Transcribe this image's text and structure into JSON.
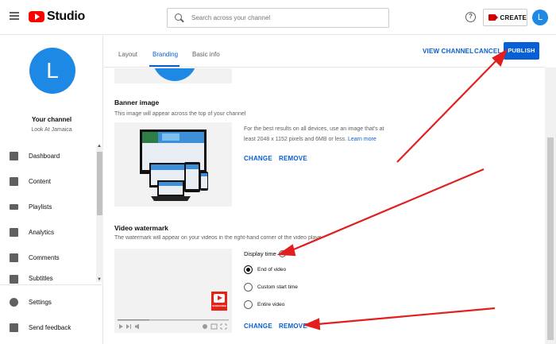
{
  "topbar": {
    "logo_text": "Studio",
    "search_placeholder": "Search across your channel",
    "help_glyph": "?",
    "create_label": "CREATE",
    "avatar_letter": "L"
  },
  "sidebar": {
    "avatar_letter": "L",
    "channel_title": "Your channel",
    "channel_name": "Look At Jamaica",
    "items": [
      {
        "label": "Dashboard",
        "icon": "dashboard-icon"
      },
      {
        "label": "Content",
        "icon": "content-icon"
      },
      {
        "label": "Playlists",
        "icon": "playlists-icon"
      },
      {
        "label": "Analytics",
        "icon": "analytics-icon"
      },
      {
        "label": "Comments",
        "icon": "comments-icon"
      },
      {
        "label": "Subtitles",
        "icon": "subtitles-icon"
      }
    ],
    "bottom_items": [
      {
        "label": "Settings",
        "icon": "gear-icon"
      },
      {
        "label": "Send feedback",
        "icon": "feedback-icon"
      }
    ]
  },
  "tabs": {
    "layout": "Layout",
    "branding": "Branding",
    "basic_info": "Basic info",
    "active": "Branding"
  },
  "header_actions": {
    "view_channel": "VIEW CHANNEL",
    "cancel": "CANCEL",
    "publish": "PUBLISH"
  },
  "banner": {
    "title": "Banner image",
    "description": "This image will appear across the top of your channel",
    "info_line1": "For the best results on all devices, use an image that's at",
    "info_line2": "least 2048 x 1152 pixels and 6MB or less.",
    "learn_more": "Learn more",
    "change": "CHANGE",
    "remove": "REMOVE"
  },
  "watermark": {
    "title": "Video watermark",
    "description": "The watermark will appear on your videos in the right-hand corner of the video player",
    "display_time_label": "Display time",
    "help_glyph": "?",
    "options": [
      "End of video",
      "Custom start time",
      "Entire video"
    ],
    "selected_option": "End of video",
    "change": "CHANGE",
    "remove": "REMOVE",
    "badge_text": "SUBSCRIBE"
  },
  "colors": {
    "accent_blue": "#065fd4",
    "avatar_blue": "#1e88e5",
    "youtube_red": "#ff0000",
    "annotation_red": "#e21f1f"
  }
}
